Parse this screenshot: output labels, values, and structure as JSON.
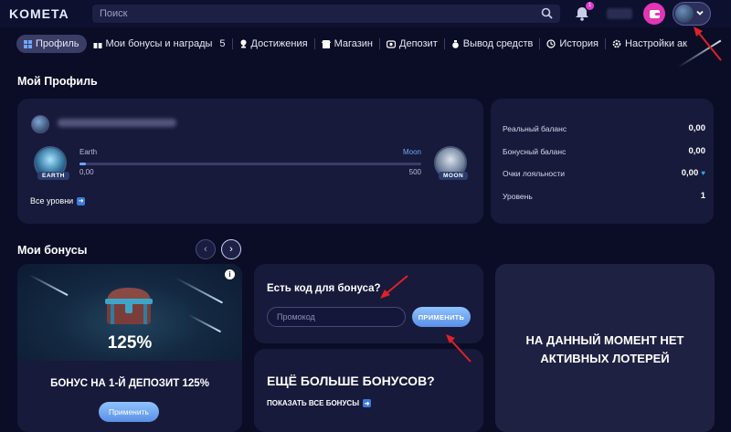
{
  "header": {
    "logo": "KOMETA",
    "search_placeholder": "Поиск",
    "notification_count": "1",
    "account_placeholder_label": ""
  },
  "nav": {
    "items": [
      {
        "label": "Профиль",
        "icon": "grid-icon",
        "active": true
      },
      {
        "label": "Мои бонусы и награды",
        "icon": "gift-icon",
        "count": "5"
      },
      {
        "label": "Достижения",
        "icon": "trophy-icon"
      },
      {
        "label": "Магазин",
        "icon": "shop-icon"
      },
      {
        "label": "Депозит",
        "icon": "deposit-icon"
      },
      {
        "label": "Вывод средств",
        "icon": "moneybag-icon"
      },
      {
        "label": "История",
        "icon": "history-icon"
      },
      {
        "label": "Настройки ак",
        "icon": "settings-icon"
      }
    ]
  },
  "profile": {
    "section_title": "Мой Профиль",
    "level_from": "Earth",
    "level_to": "Moon",
    "level_from_badge": "EARTH",
    "level_to_badge": "MOON",
    "progress_min": "0,00",
    "progress_max": "500",
    "progress_fraction": 0.0,
    "all_levels_label": "Все уровни"
  },
  "balance": {
    "rows": [
      {
        "label": "Реальный баланс",
        "value": "0,00"
      },
      {
        "label": "Бонусный баланс",
        "value": "0,00"
      },
      {
        "label": "Очки лояльности",
        "value": "0,00"
      },
      {
        "label": "Уровень",
        "value": "1"
      }
    ]
  },
  "bonuses": {
    "section_title": "Мои бонусы",
    "card": {
      "percent": "125%",
      "title": "БОНУС НА 1-Й ДЕПОЗИТ 125%",
      "button": "Применить"
    },
    "promo": {
      "title": "Есть код для бонуса?",
      "input_placeholder": "Промокод",
      "button": "ПРИМЕНИТЬ"
    },
    "more": {
      "title": "ЕЩЁ БОЛЬШЕ БОНУСОВ?",
      "link": "ПОКАЗАТЬ ВСЕ БОНУСЫ"
    }
  },
  "lottery": {
    "line1": "НА ДАННЫЙ МОМЕНТ НЕТ",
    "line2": "АКТИВНЫХ ЛОТЕРЕЙ"
  },
  "colors": {
    "background": "#0b0d26",
    "card": "#171a3a",
    "accent_button": "#6fa7ff",
    "wallet_button": "#e236b6",
    "annotation_arrow": "#e0202a"
  }
}
